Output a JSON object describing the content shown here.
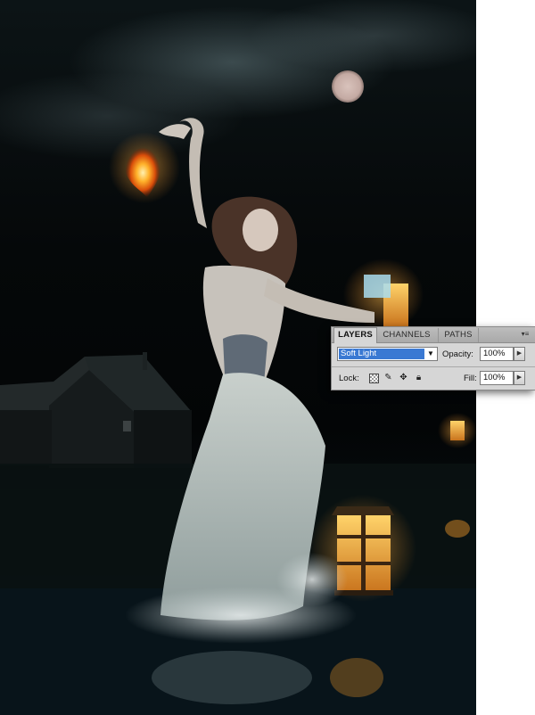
{
  "layers_panel": {
    "tabs": [
      {
        "label": "LAYERS",
        "active": true
      },
      {
        "label": "CHANNELS",
        "active": false
      },
      {
        "label": "PATHS",
        "active": false
      }
    ],
    "menu_icon": "panel-menu-icon",
    "blend_mode": "Soft Light",
    "opacity_label": "Opacity:",
    "opacity_value": "100%",
    "lock_label": "Lock:",
    "fill_label": "Fill:",
    "fill_value": "100%",
    "lock_icons": [
      "lock-transparent-pixels-icon",
      "lock-image-pixels-icon",
      "lock-position-icon",
      "lock-all-icon"
    ]
  },
  "colors": {
    "panel_bg": "#d6d6d6",
    "selection_blue": "#3a79d3",
    "lantern_glow": "#f2b548"
  }
}
